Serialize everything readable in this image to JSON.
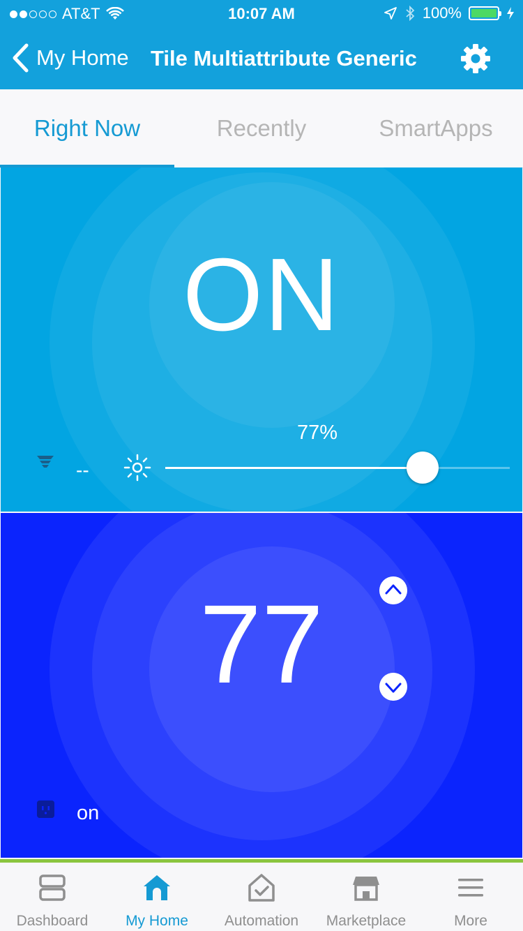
{
  "status_bar": {
    "carrier": "AT&T",
    "time": "10:07 AM",
    "battery": "100%"
  },
  "nav": {
    "back_label": "My Home",
    "title": "Tile Multiattribute Generic"
  },
  "tabs": [
    {
      "label": "Right Now",
      "active": true
    },
    {
      "label": "Recently",
      "active": false
    },
    {
      "label": "SmartApps",
      "active": false
    }
  ],
  "tile1": {
    "main_value": "ON",
    "level_label": "77%",
    "level": 0.77,
    "secondary_value": "--",
    "color": "#02a5e2"
  },
  "tile2": {
    "main_value": "77",
    "secondary_value": "on",
    "color": "#0b24fd"
  },
  "bottom_nav": [
    {
      "label": "Dashboard",
      "icon": "dashboard-icon",
      "active": false
    },
    {
      "label": "My Home",
      "icon": "home-icon",
      "active": true
    },
    {
      "label": "Automation",
      "icon": "automation-icon",
      "active": false
    },
    {
      "label": "Marketplace",
      "icon": "marketplace-icon",
      "active": false
    },
    {
      "label": "More",
      "icon": "more-icon",
      "active": false
    }
  ],
  "colors": {
    "header": "#13a1dc",
    "accent": "#159ad3",
    "inactive": "#8f8f8f"
  }
}
